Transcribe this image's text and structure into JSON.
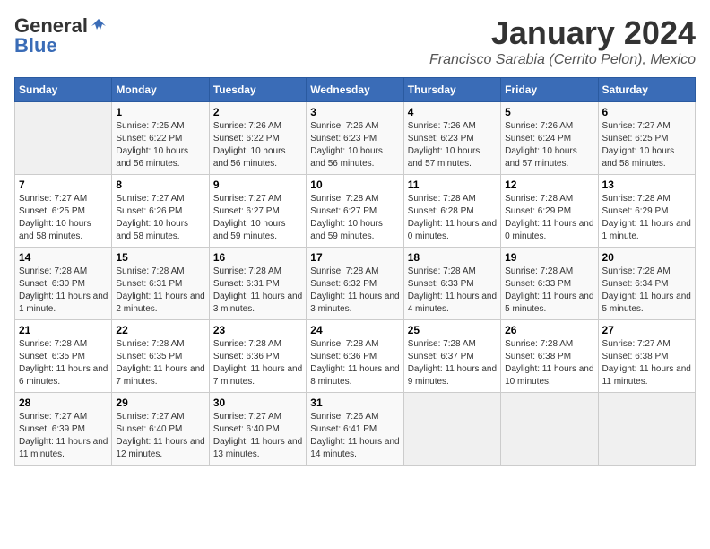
{
  "header": {
    "logo_general": "General",
    "logo_blue": "Blue",
    "calendar_title": "January 2024",
    "calendar_subtitle": "Francisco Sarabia (Cerrito Pelon), Mexico"
  },
  "days_of_week": [
    "Sunday",
    "Monday",
    "Tuesday",
    "Wednesday",
    "Thursday",
    "Friday",
    "Saturday"
  ],
  "weeks": [
    [
      {
        "day": "",
        "empty": true
      },
      {
        "day": "1",
        "sunrise": "Sunrise: 7:25 AM",
        "sunset": "Sunset: 6:22 PM",
        "daylight": "Daylight: 10 hours and 56 minutes."
      },
      {
        "day": "2",
        "sunrise": "Sunrise: 7:26 AM",
        "sunset": "Sunset: 6:22 PM",
        "daylight": "Daylight: 10 hours and 56 minutes."
      },
      {
        "day": "3",
        "sunrise": "Sunrise: 7:26 AM",
        "sunset": "Sunset: 6:23 PM",
        "daylight": "Daylight: 10 hours and 56 minutes."
      },
      {
        "day": "4",
        "sunrise": "Sunrise: 7:26 AM",
        "sunset": "Sunset: 6:23 PM",
        "daylight": "Daylight: 10 hours and 57 minutes."
      },
      {
        "day": "5",
        "sunrise": "Sunrise: 7:26 AM",
        "sunset": "Sunset: 6:24 PM",
        "daylight": "Daylight: 10 hours and 57 minutes."
      },
      {
        "day": "6",
        "sunrise": "Sunrise: 7:27 AM",
        "sunset": "Sunset: 6:25 PM",
        "daylight": "Daylight: 10 hours and 58 minutes."
      }
    ],
    [
      {
        "day": "7",
        "sunrise": "Sunrise: 7:27 AM",
        "sunset": "Sunset: 6:25 PM",
        "daylight": "Daylight: 10 hours and 58 minutes."
      },
      {
        "day": "8",
        "sunrise": "Sunrise: 7:27 AM",
        "sunset": "Sunset: 6:26 PM",
        "daylight": "Daylight: 10 hours and 58 minutes."
      },
      {
        "day": "9",
        "sunrise": "Sunrise: 7:27 AM",
        "sunset": "Sunset: 6:27 PM",
        "daylight": "Daylight: 10 hours and 59 minutes."
      },
      {
        "day": "10",
        "sunrise": "Sunrise: 7:28 AM",
        "sunset": "Sunset: 6:27 PM",
        "daylight": "Daylight: 10 hours and 59 minutes."
      },
      {
        "day": "11",
        "sunrise": "Sunrise: 7:28 AM",
        "sunset": "Sunset: 6:28 PM",
        "daylight": "Daylight: 11 hours and 0 minutes."
      },
      {
        "day": "12",
        "sunrise": "Sunrise: 7:28 AM",
        "sunset": "Sunset: 6:29 PM",
        "daylight": "Daylight: 11 hours and 0 minutes."
      },
      {
        "day": "13",
        "sunrise": "Sunrise: 7:28 AM",
        "sunset": "Sunset: 6:29 PM",
        "daylight": "Daylight: 11 hours and 1 minute."
      }
    ],
    [
      {
        "day": "14",
        "sunrise": "Sunrise: 7:28 AM",
        "sunset": "Sunset: 6:30 PM",
        "daylight": "Daylight: 11 hours and 1 minute."
      },
      {
        "day": "15",
        "sunrise": "Sunrise: 7:28 AM",
        "sunset": "Sunset: 6:31 PM",
        "daylight": "Daylight: 11 hours and 2 minutes."
      },
      {
        "day": "16",
        "sunrise": "Sunrise: 7:28 AM",
        "sunset": "Sunset: 6:31 PM",
        "daylight": "Daylight: 11 hours and 3 minutes."
      },
      {
        "day": "17",
        "sunrise": "Sunrise: 7:28 AM",
        "sunset": "Sunset: 6:32 PM",
        "daylight": "Daylight: 11 hours and 3 minutes."
      },
      {
        "day": "18",
        "sunrise": "Sunrise: 7:28 AM",
        "sunset": "Sunset: 6:33 PM",
        "daylight": "Daylight: 11 hours and 4 minutes."
      },
      {
        "day": "19",
        "sunrise": "Sunrise: 7:28 AM",
        "sunset": "Sunset: 6:33 PM",
        "daylight": "Daylight: 11 hours and 5 minutes."
      },
      {
        "day": "20",
        "sunrise": "Sunrise: 7:28 AM",
        "sunset": "Sunset: 6:34 PM",
        "daylight": "Daylight: 11 hours and 5 minutes."
      }
    ],
    [
      {
        "day": "21",
        "sunrise": "Sunrise: 7:28 AM",
        "sunset": "Sunset: 6:35 PM",
        "daylight": "Daylight: 11 hours and 6 minutes."
      },
      {
        "day": "22",
        "sunrise": "Sunrise: 7:28 AM",
        "sunset": "Sunset: 6:35 PM",
        "daylight": "Daylight: 11 hours and 7 minutes."
      },
      {
        "day": "23",
        "sunrise": "Sunrise: 7:28 AM",
        "sunset": "Sunset: 6:36 PM",
        "daylight": "Daylight: 11 hours and 7 minutes."
      },
      {
        "day": "24",
        "sunrise": "Sunrise: 7:28 AM",
        "sunset": "Sunset: 6:36 PM",
        "daylight": "Daylight: 11 hours and 8 minutes."
      },
      {
        "day": "25",
        "sunrise": "Sunrise: 7:28 AM",
        "sunset": "Sunset: 6:37 PM",
        "daylight": "Daylight: 11 hours and 9 minutes."
      },
      {
        "day": "26",
        "sunrise": "Sunrise: 7:28 AM",
        "sunset": "Sunset: 6:38 PM",
        "daylight": "Daylight: 11 hours and 10 minutes."
      },
      {
        "day": "27",
        "sunrise": "Sunrise: 7:27 AM",
        "sunset": "Sunset: 6:38 PM",
        "daylight": "Daylight: 11 hours and 11 minutes."
      }
    ],
    [
      {
        "day": "28",
        "sunrise": "Sunrise: 7:27 AM",
        "sunset": "Sunset: 6:39 PM",
        "daylight": "Daylight: 11 hours and 11 minutes."
      },
      {
        "day": "29",
        "sunrise": "Sunrise: 7:27 AM",
        "sunset": "Sunset: 6:40 PM",
        "daylight": "Daylight: 11 hours and 12 minutes."
      },
      {
        "day": "30",
        "sunrise": "Sunrise: 7:27 AM",
        "sunset": "Sunset: 6:40 PM",
        "daylight": "Daylight: 11 hours and 13 minutes."
      },
      {
        "day": "31",
        "sunrise": "Sunrise: 7:26 AM",
        "sunset": "Sunset: 6:41 PM",
        "daylight": "Daylight: 11 hours and 14 minutes."
      },
      {
        "day": "",
        "empty": true
      },
      {
        "day": "",
        "empty": true
      },
      {
        "day": "",
        "empty": true
      }
    ]
  ]
}
